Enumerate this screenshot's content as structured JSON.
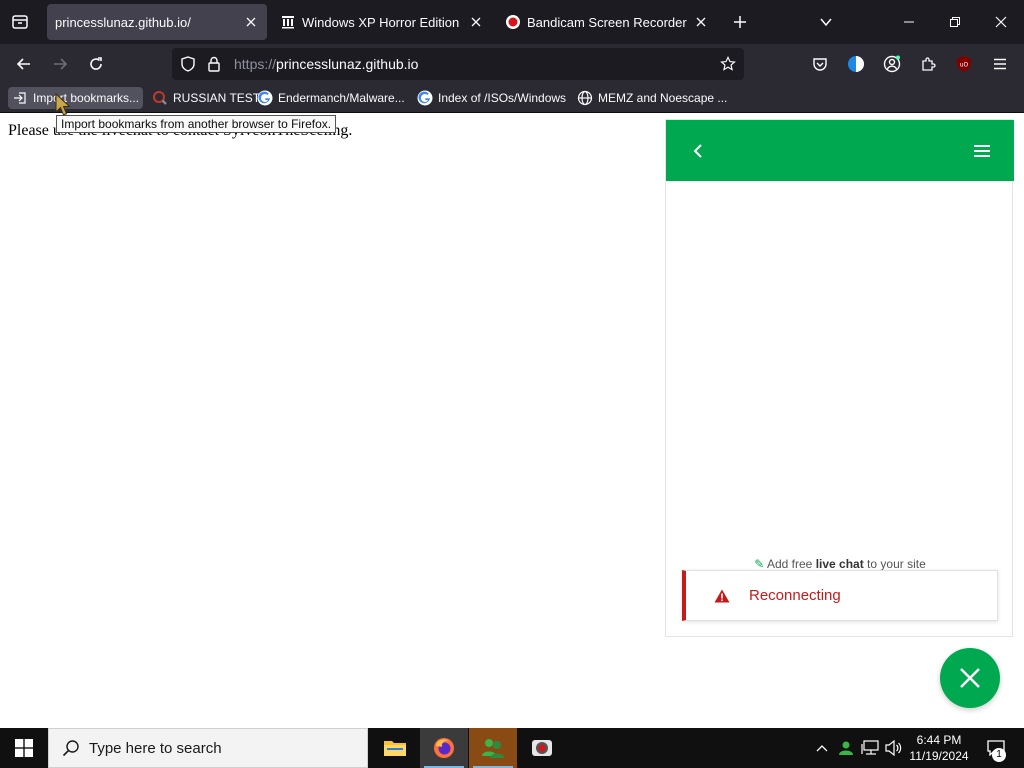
{
  "tabs": [
    {
      "title": "princesslunaz.github.io/",
      "active": true,
      "icon": "none"
    },
    {
      "title": "Windows XP Horror Edition (De",
      "active": false,
      "icon": "archive-icon"
    },
    {
      "title": "Bandicam Screen Recorder Dow",
      "active": false,
      "icon": "bandicam-icon"
    }
  ],
  "urlbar": {
    "scheme": "https://",
    "host": "princesslunaz.github.io"
  },
  "bookmarks": [
    {
      "label": "Import bookmarks...",
      "icon": "import-icon"
    },
    {
      "label": "RUSSIAN TEST",
      "icon": "magnifier-icon"
    },
    {
      "label": "Endermanch/Malware...",
      "icon": "google-icon"
    },
    {
      "label": "Index of /ISOs/Windows",
      "icon": "google-icon"
    },
    {
      "label": "MEMZ and Noescape ...",
      "icon": "globe-icon"
    }
  ],
  "tooltip": "Import bookmarks from another browser to Firefox.",
  "page": {
    "text": "Please use the livechat to contact SylveonTheSceling."
  },
  "chat": {
    "promo_prefix": "Add free ",
    "promo_bold": "live chat",
    "promo_suffix": " to your site",
    "status": "Reconnecting"
  },
  "taskbar": {
    "search_placeholder": "Type here to search",
    "time": "6:44 PM",
    "date": "11/19/2024",
    "notification_count": "1"
  },
  "colors": {
    "chat_green": "#00a84f",
    "error_red": "#c51a1a",
    "firefox_dark": "#2b2a33"
  }
}
